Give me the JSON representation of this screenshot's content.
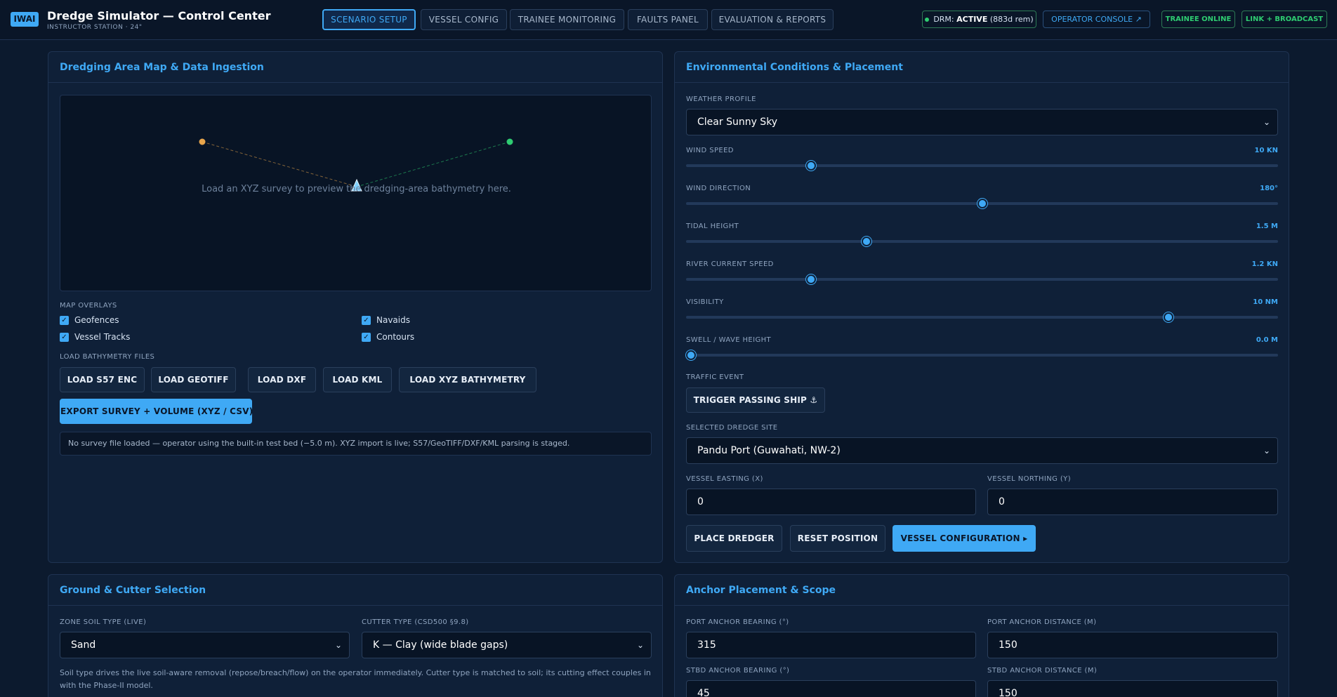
{
  "header": {
    "logo": "IWAI",
    "title": "Dredge Simulator — Control Center",
    "subtitle": "INSTRUCTOR STATION · 24\"",
    "tabs": [
      {
        "label": "SCENARIO SETUP",
        "active": true
      },
      {
        "label": "VESSEL CONFIG",
        "active": false
      },
      {
        "label": "TRAINEE MONITORING",
        "active": false
      },
      {
        "label": "FAULTS PANEL",
        "active": false
      },
      {
        "label": "EVALUATION & REPORTS",
        "active": false
      }
    ],
    "drm_prefix": "DRM:",
    "drm_status": "ACTIVE",
    "drm_remaining": "(883d rem)",
    "operator_console": "OPERATOR CONSOLE ↗",
    "trainee_status": "TRAINEE ONLINE",
    "link_status": "LINK + BROADCAST"
  },
  "map_panel": {
    "title": "Dredging Area Map & Data Ingestion",
    "hint": "Load an XYZ survey to preview the dredging-area bathymetry here.",
    "overlays_label": "MAP OVERLAYS",
    "overlays": [
      {
        "label": "Geofences",
        "checked": true
      },
      {
        "label": "Navaids",
        "checked": true
      },
      {
        "label": "Vessel Tracks",
        "checked": true
      },
      {
        "label": "Contours",
        "checked": true
      }
    ],
    "load_label": "LOAD BATHYMETRY FILES",
    "load_buttons": [
      "LOAD S57 ENC",
      "LOAD GEOTIFF",
      "LOAD DXF",
      "LOAD KML",
      "LOAD XYZ BATHYMETRY"
    ],
    "export_button": "EXPORT SURVEY + VOLUME (XYZ / CSV)",
    "status": "No survey file loaded — operator using the built-in test bed (−5.0 m). XYZ import is live; S57/GeoTIFF/DXF/KML parsing is staged.",
    "colors": {
      "anchor_port": "#e8a54b",
      "anchor_stbd": "#2ecc71",
      "vessel": "#7fd0ff"
    }
  },
  "env_panel": {
    "title": "Environmental Conditions & Placement",
    "weather_label": "WEATHER PROFILE",
    "weather_value": "Clear Sunny Sky",
    "sliders": [
      {
        "label": "WIND SPEED",
        "value": "10 KN",
        "fraction": 0.206
      },
      {
        "label": "WIND DIRECTION",
        "value": "180°",
        "fraction": 0.5
      },
      {
        "label": "TIDAL HEIGHT",
        "value": "1.5 M",
        "fraction": 0.302
      },
      {
        "label": "RIVER CURRENT SPEED",
        "value": "1.2 KN",
        "fraction": 0.206
      },
      {
        "label": "VISIBILITY",
        "value": "10 NM",
        "fraction": 0.82
      },
      {
        "label": "SWELL / WAVE HEIGHT",
        "value": "0.0 M",
        "fraction": 0.0
      }
    ],
    "traffic_label": "TRAFFIC EVENT",
    "traffic_button": "TRIGGER PASSING SHIP ⚓",
    "site_label": "SELECTED DREDGE SITE",
    "site_value": "Pandu Port (Guwahati, NW-2)",
    "easting_label": "VESSEL EASTING (X)",
    "easting_value": "0",
    "northing_label": "VESSEL NORTHING (Y)",
    "northing_value": "0",
    "place_button": "PLACE DREDGER",
    "reset_button": "RESET POSITION",
    "vessel_config_button": "VESSEL CONFIGURATION ▸"
  },
  "ground_panel": {
    "title": "Ground & Cutter Selection",
    "soil_label": "ZONE SOIL TYPE (LIVE)",
    "soil_value": "Sand",
    "cutter_label": "CUTTER TYPE (CSD500 §9.8)",
    "cutter_value": "K — Clay (wide blade gaps)",
    "note": "Soil type drives the live soil-aware removal (repose/breach/flow) on the operator immediately. Cutter type is matched to soil; its cutting effect couples in with the Phase-II model."
  },
  "anchor_panel": {
    "title": "Anchor Placement & Scope",
    "port_bearing_label": "PORT ANCHOR BEARING (°)",
    "port_bearing_value": "315",
    "port_distance_label": "PORT ANCHOR DISTANCE (M)",
    "port_distance_value": "150",
    "stbd_bearing_label": "STBD ANCHOR BEARING (°)",
    "stbd_bearing_value": "45",
    "stbd_distance_label": "STBD ANCHOR DISTANCE (M)",
    "stbd_distance_value": "150"
  }
}
